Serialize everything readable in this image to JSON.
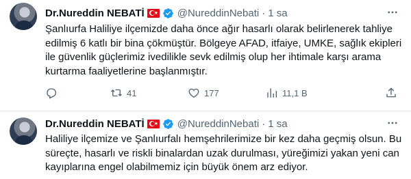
{
  "tweets": [
    {
      "author": {
        "name": "Dr.Nureddin NEBATİ",
        "handle": "@NureddinNebati",
        "separator": "·",
        "time": "1 sa"
      },
      "text": "Şanlıurfa Haliliye ilçemizde daha önce ağır hasarlı olarak belirlenerek tahliye edilmiş 6 katlı bir bina çökmüştür. Bölgeye AFAD, itfaiye, UMKE, sağlık ekipleri ile güvenlik güçlerimiz ivedilikle sevk edilmiş olup her ihtimale karşı arama kurtarma faaliyetlerine başlanmıştır.",
      "metrics": {
        "replies": "",
        "retweets": "41",
        "likes": "177",
        "views": "11,1 B"
      }
    },
    {
      "author": {
        "name": "Dr.Nureddin NEBATİ",
        "handle": "@NureddinNebati",
        "separator": "·",
        "time": "1 sa"
      },
      "text": "Haliliye ilçemize ve Şanlıurfalı hemşehrilerimize bir kez daha geçmiş olsun. Bu süreçte, hasarlı ve riskli binalardan uzak durulması, yüreğimizi yakan yeni can kayıplarına engel olabilmemiz için büyük önem arz ediyor."
    }
  ],
  "colors": {
    "text": "#0f1419",
    "secondary": "#536471",
    "verified": "#1d9bf0",
    "flag": "#e30a17"
  },
  "icons": [
    "avatar",
    "turkey-flag-icon",
    "verified-badge-icon",
    "more-icon",
    "reply-icon",
    "retweet-icon",
    "like-icon",
    "views-icon",
    "share-icon"
  ]
}
